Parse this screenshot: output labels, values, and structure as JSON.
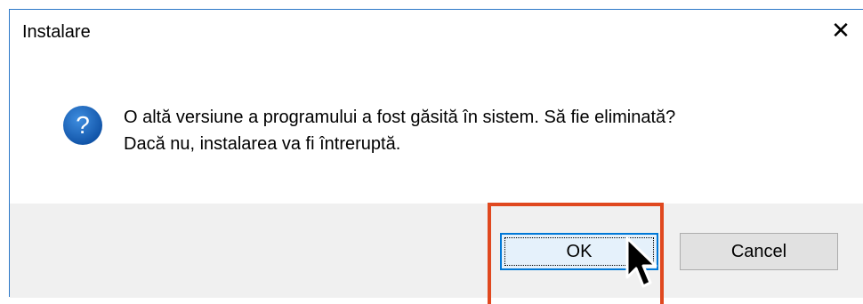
{
  "dialog": {
    "title": "Instalare",
    "close_glyph": "✕",
    "icon": "question-icon",
    "icon_glyph": "?",
    "message_line1": "O altă versiune a programului a fost găsită în sistem. Să fie eliminată?",
    "message_line2": "Dacă nu, instalarea va fi întreruptă.",
    "buttons": {
      "ok_label": "OK",
      "cancel_label": "Cancel"
    }
  },
  "colors": {
    "accent": "#0078d7",
    "highlight": "#e0481f",
    "footer": "#f0f0f0",
    "icon_blue": "#1565c0"
  }
}
